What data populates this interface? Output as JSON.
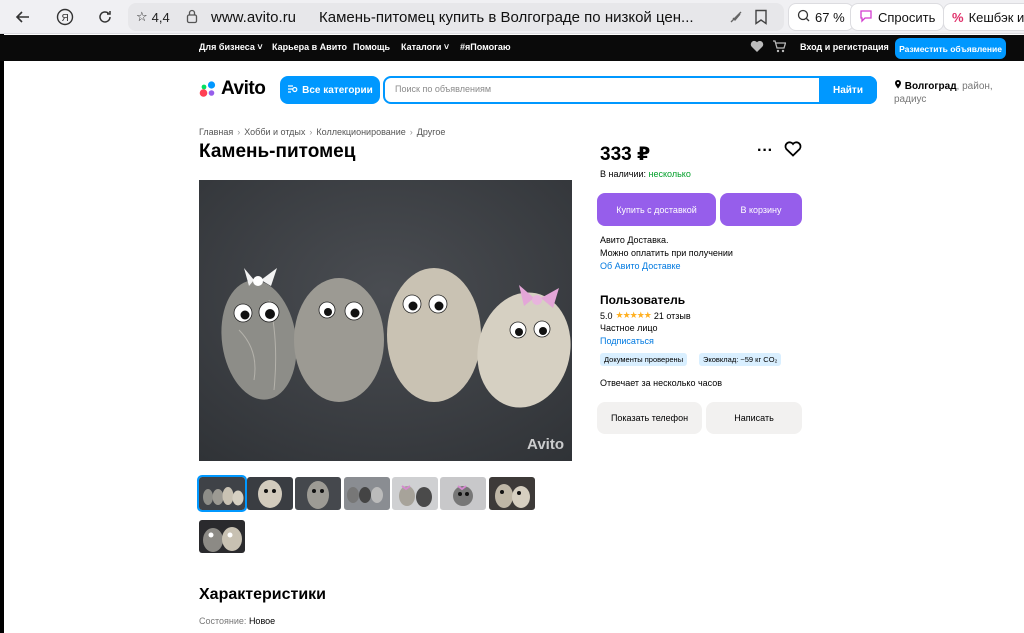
{
  "browser": {
    "rating": "4,4",
    "domain": "www.avito.ru",
    "page_title": "Камень-питомец купить в Волгограде по низкой цен...",
    "zoom": "67 %",
    "ask": "Спросить",
    "cashback": "Кешбэк и"
  },
  "top_nav": {
    "items": [
      "Для бизнеса",
      "Карьера в Авито",
      "Помощь",
      "Каталоги",
      "#яПомогаю"
    ],
    "login": "Вход и регистрация",
    "post_ad": "Разместить объявление"
  },
  "header": {
    "logo": "Avito",
    "categories": "Все категории",
    "search_placeholder": "Поиск по объявлениям",
    "search_button": "Найти",
    "location_city": "Волгоград",
    "location_rest": ", район, радиус"
  },
  "breadcrumbs": [
    "Главная",
    "Хобби и отдых",
    "Коллекционирование",
    "Другое"
  ],
  "item": {
    "title": "Камень-питомец",
    "price": "333 ₽",
    "stock_label": "В наличии:",
    "stock_value": "несколько",
    "buy_button": "Купить с доставкой",
    "cart_button": "В корзину",
    "delivery_line1": "Авито Доставка.",
    "delivery_line2": "Можно оплатить при получении",
    "delivery_link": "Об Авито Доставке",
    "watermark": "Avito"
  },
  "seller": {
    "name": "Пользователь",
    "rating": "5.0",
    "reviews": "21 отзыв",
    "type": "Частное лицо",
    "subscribe": "Подписаться",
    "badge_docs": "Документы проверены",
    "badge_eco": "Эковклад: ~59 кг CO₂",
    "replies": "Отвечает за несколько часов",
    "phone_button": "Показать телефон",
    "write_button": "Написать"
  },
  "characteristics": {
    "title": "Характеристики",
    "condition_label": "Состояние:",
    "condition_value": "Новое"
  },
  "colors": {
    "accent": "#0098ff",
    "purple": "#965eeb",
    "green": "#02a02a",
    "link": "#0079e0"
  }
}
